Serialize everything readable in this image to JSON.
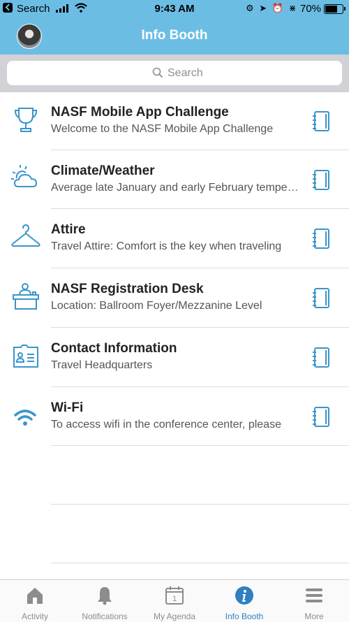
{
  "status_bar": {
    "back_label": "Search",
    "time": "9:43 AM",
    "battery_percent": "70%",
    "battery_level": 0.7
  },
  "header": {
    "title": "Info Booth",
    "avatar": "user-avatar"
  },
  "search": {
    "placeholder": "Search"
  },
  "items": [
    {
      "title": "NASF Mobile App Challenge",
      "subtitle": "Welcome to the NASF Mobile App Challenge",
      "icon": "trophy-icon"
    },
    {
      "title": "Climate/Weather",
      "subtitle": "Average late January and early February temperatures",
      "icon": "weather-icon"
    },
    {
      "title": "Attire",
      "subtitle": "Travel Attire: Comfort is the key when traveling",
      "icon": "hanger-icon"
    },
    {
      "title": "NASF Registration Desk",
      "subtitle": "Location: Ballroom Foyer/Mezzanine Level",
      "icon": "desk-icon"
    },
    {
      "title": "Contact Information",
      "subtitle": "Travel Headquarters",
      "icon": "contact-card-icon"
    },
    {
      "title": "Wi-Fi",
      "subtitle": "To access wifi in the conference center, please",
      "icon": "wifi-icon"
    }
  ],
  "tabs": [
    {
      "label": "Activity",
      "icon": "home-icon"
    },
    {
      "label": "Notifications",
      "icon": "bell-icon"
    },
    {
      "label": "My Agenda",
      "icon": "calendar-icon",
      "badge": "1"
    },
    {
      "label": "Info Booth",
      "icon": "info-icon",
      "active": true
    },
    {
      "label": "More",
      "icon": "menu-icon"
    }
  ],
  "colors": {
    "header": "#6cbde3",
    "icon_blue": "#3a95c9",
    "active_tab": "#2f7fc1",
    "inactive_tab": "#8c8c8c"
  }
}
